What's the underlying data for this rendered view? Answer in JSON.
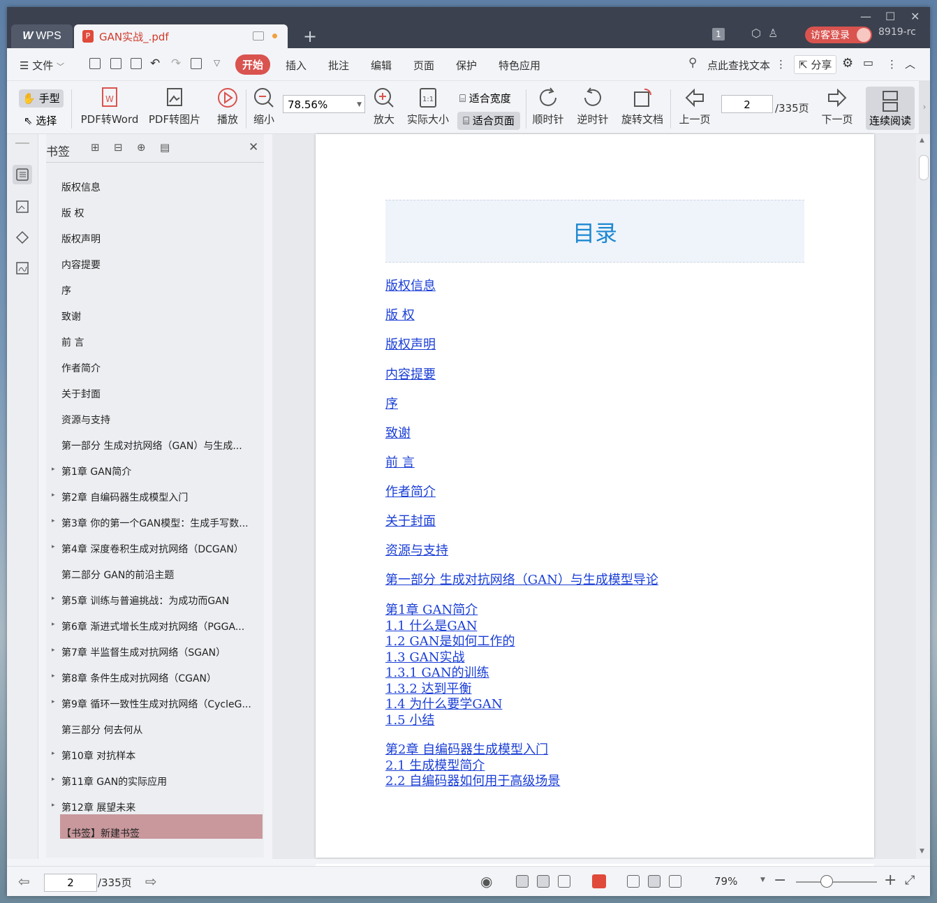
{
  "titlebar": {
    "wps_tab": "WPS",
    "doc_tab": "GAN实战_.pdf",
    "badge_count": "1",
    "login": "访客登录",
    "user": "8919-rc"
  },
  "menu": {
    "file": "文件",
    "items": [
      "开始",
      "插入",
      "批注",
      "编辑",
      "页面",
      "保护",
      "特色应用"
    ],
    "search": "点此查找文本",
    "share": "分享"
  },
  "toolbar": {
    "hand": "手型",
    "select": "选择",
    "pdf2word": "PDF转Word",
    "pdf2img": "PDF转图片",
    "play": "播放",
    "zoom_out": "缩小",
    "zoom_value": "78.56%",
    "zoom_in": "放大",
    "actual_size": "实际大小",
    "fit_width": "适合宽度",
    "fit_page": "适合页面",
    "clockwise": "顺时针",
    "counter_clockwise": "逆时针",
    "rotate_doc": "旋转文档",
    "prev_page": "上一页",
    "page_value": "2",
    "page_total": "/335页",
    "next_page": "下一页",
    "continuous": "连续阅读"
  },
  "panel": {
    "title": "书签",
    "bookmarks": [
      {
        "label": "版权信息",
        "expandable": false
      },
      {
        "label": "版 权",
        "expandable": false
      },
      {
        "label": "版权声明",
        "expandable": false
      },
      {
        "label": "内容提要",
        "expandable": false
      },
      {
        "label": "序",
        "expandable": false
      },
      {
        "label": "致谢",
        "expandable": false
      },
      {
        "label": "前 言",
        "expandable": false
      },
      {
        "label": "作者简介",
        "expandable": false
      },
      {
        "label": "关于封面",
        "expandable": false
      },
      {
        "label": "资源与支持",
        "expandable": false
      },
      {
        "label": "第一部分 生成对抗网络（GAN）与生成...",
        "expandable": false
      },
      {
        "label": "第1章 GAN简介",
        "expandable": true
      },
      {
        "label": "第2章 自编码器生成模型入门",
        "expandable": true
      },
      {
        "label": "第3章 你的第一个GAN模型：生成手写数...",
        "expandable": true
      },
      {
        "label": "第4章 深度卷积生成对抗网络（DCGAN）",
        "expandable": true
      },
      {
        "label": "第二部分 GAN的前沿主题",
        "expandable": false
      },
      {
        "label": "第5章 训练与普遍挑战：为成功而GAN",
        "expandable": true
      },
      {
        "label": "第6章 渐进式增长生成对抗网络（PGGA...",
        "expandable": true
      },
      {
        "label": "第7章 半监督生成对抗网络（SGAN）",
        "expandable": true
      },
      {
        "label": "第8章 条件生成对抗网络（CGAN）",
        "expandable": true
      },
      {
        "label": "第9章 循环一致性生成对抗网络（CycleG...",
        "expandable": true
      },
      {
        "label": "第三部分 何去何从",
        "expandable": false
      },
      {
        "label": "第10章 对抗样本",
        "expandable": true
      },
      {
        "label": "第11章 GAN的实际应用",
        "expandable": true
      },
      {
        "label": "第12章 展望未来",
        "expandable": true
      },
      {
        "label": "【书签】新建书签",
        "expandable": false
      }
    ]
  },
  "document": {
    "toc_title": "目录",
    "links": [
      "版权信息",
      "版 权",
      "版权声明",
      "内容提要",
      "序",
      "致谢",
      "前 言",
      "作者简介",
      "关于封面",
      "资源与支持",
      "第一部分 生成对抗网络（GAN）与生成模型导论",
      "第1章 GAN简介",
      "1.1 什么是GAN",
      "1.2 GAN是如何工作的",
      "1.3 GAN实战",
      "1.3.1 GAN的训练",
      "1.3.2 达到平衡",
      "1.4 为什么要学GAN",
      "1.5 小结",
      "第2章 自编码器生成模型入门",
      "2.1 生成模型简介",
      "2.2 自编码器如何用于高级场景"
    ]
  },
  "status": {
    "page_value": "2",
    "page_total": "/335页",
    "zoom": "79%"
  }
}
